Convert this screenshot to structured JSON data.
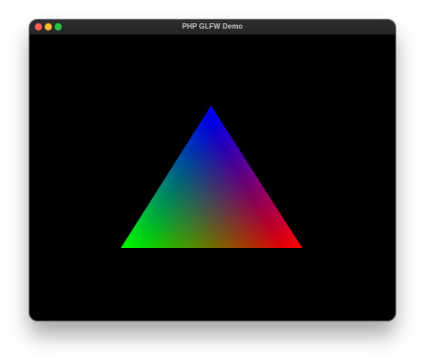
{
  "window": {
    "title": "PHP GLFW Demo",
    "controls": {
      "close_color": "#fe5f57",
      "minimize_color": "#febc2e",
      "maximize_color": "#28c840"
    }
  },
  "scene": {
    "background_color": "#000000",
    "shape": "triangle",
    "vertex_colors": {
      "top": "#0000ff",
      "bottom_left": "#00ff00",
      "bottom_right": "#ff0000"
    }
  }
}
